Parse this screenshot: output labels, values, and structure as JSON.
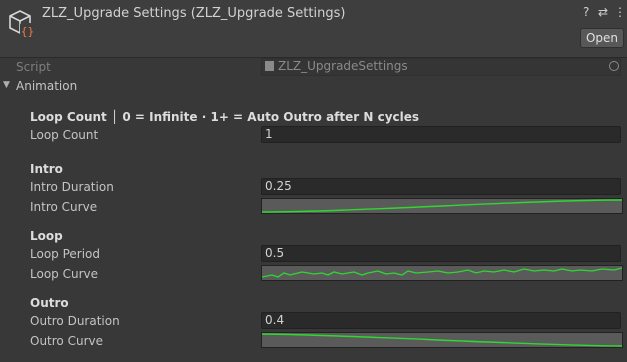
{
  "header": {
    "title": "ZLZ_Upgrade Settings (ZLZ_Upgrade Settings)",
    "open_label": "Open",
    "help_icon": "?",
    "settings_icon": "⇄",
    "menu_icon": "⋮"
  },
  "script_row": {
    "label": "Script",
    "value": "ZLZ_UpgradeSettings"
  },
  "foldout": {
    "label": "Animation",
    "arrow": "▼"
  },
  "loop_count": {
    "header": "Loop Count │ 0 = Infinite · 1+ = Auto Outro after N cycles",
    "label": "Loop Count",
    "value": "1"
  },
  "intro": {
    "header": "Intro",
    "duration_label": "Intro Duration",
    "duration_value": "0.25",
    "curve_label": "Intro Curve"
  },
  "loop": {
    "header": "Loop",
    "period_label": "Loop Period",
    "period_value": "0.5",
    "curve_label": "Loop Curve"
  },
  "outro": {
    "header": "Outro",
    "duration_label": "Outro Duration",
    "duration_value": "0.4",
    "curve_label": "Outro Curve"
  },
  "colors": {
    "curve_line": "#2ed82e",
    "curve_bg": "#5a5a5a",
    "panel_bg": "#383838",
    "header_bg": "#3e3e3e"
  }
}
